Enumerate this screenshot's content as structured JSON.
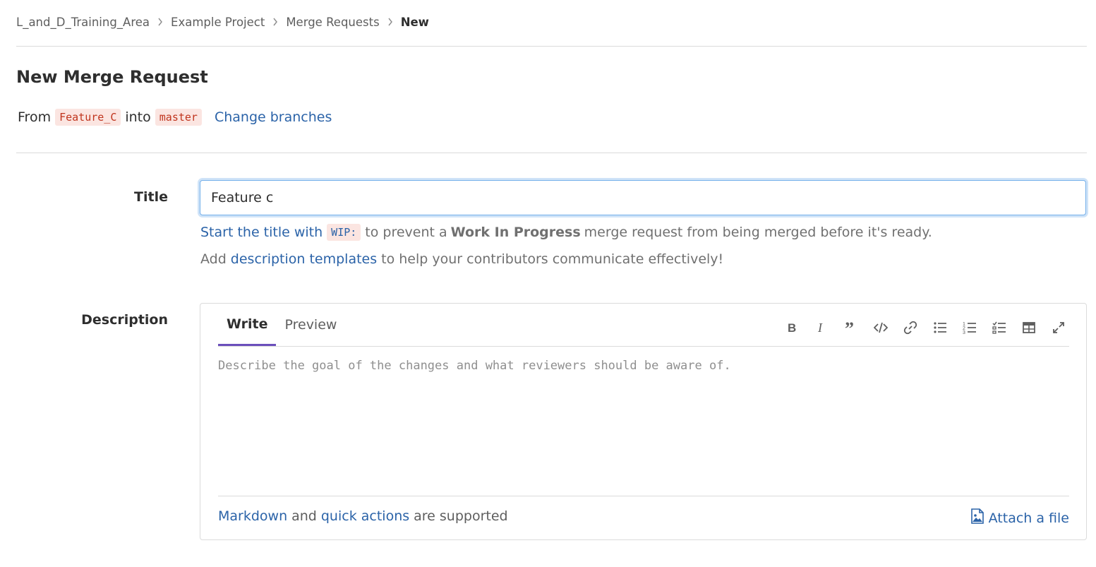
{
  "breadcrumb": {
    "items": [
      "L_and_D_Training_Area",
      "Example Project",
      "Merge Requests",
      "New"
    ]
  },
  "page_title": "New Merge Request",
  "branches": {
    "from_label": "From",
    "source": "Feature_C",
    "into_label": "into",
    "target": "master",
    "change_link": "Change branches"
  },
  "title_field": {
    "label": "Title",
    "value": "Feature c"
  },
  "hints": {
    "wip_link": "Start the title with",
    "wip_code": "WIP:",
    "wip_pre": "to prevent a",
    "wip_bold": "Work In Progress",
    "wip_post": "merge request from being merged before it's ready.",
    "templates_pre": "Add",
    "templates_link": "description templates",
    "templates_post": "to help your contributors communicate effectively!"
  },
  "description": {
    "label": "Description",
    "tabs": [
      "Write",
      "Preview"
    ],
    "placeholder": "Describe the goal of the changes and what reviewers should be aware of.",
    "toolbar_icons": [
      "bold-icon",
      "italic-icon",
      "quote-icon",
      "code-icon",
      "link-icon",
      "bulleted-list-icon",
      "numbered-list-icon",
      "task-list-icon",
      "table-icon",
      "fullscreen-icon"
    ],
    "footer": {
      "markdown_link": "Markdown",
      "and": "and",
      "quick_actions_link": "quick actions",
      "supported": "are supported",
      "attach_label": "Attach a file"
    }
  },
  "colors": {
    "link": "#2b63a8",
    "active_tab_underline": "#6b4fbb",
    "code_text": "#c0341d",
    "code_bg": "#fbe5e1",
    "focus_border": "#73afea"
  }
}
